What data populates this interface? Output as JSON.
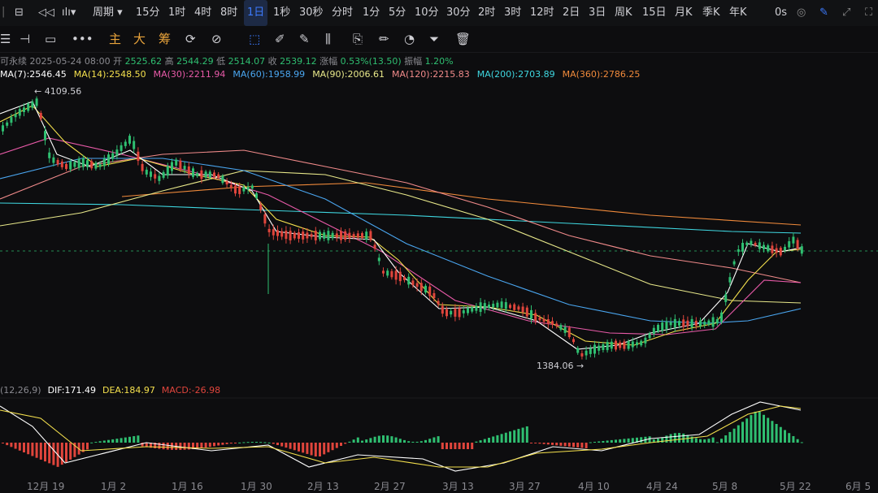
{
  "topbar": {
    "items": [
      "|",
      "⊟",
      "◁◁",
      "ılı▾",
      "周期 ▾",
      "15分",
      "1时",
      "4时",
      "8时",
      "1日",
      "1秒",
      "30秒",
      "分时",
      "1分",
      "5分",
      "10分",
      "30分",
      "2时",
      "3时",
      "12时",
      "2日",
      "3日",
      "周K",
      "15日",
      "月K",
      "季K",
      "年K"
    ],
    "active": "1日",
    "right_label": "0s"
  },
  "toolbar": {
    "labels": [
      "主",
      "大",
      "筹"
    ]
  },
  "info": {
    "symbol_suffix": "可永续",
    "date": "2025-05-24 08:00",
    "open_label": "开",
    "open": "2525.62",
    "high_label": "高",
    "high": "2544.29",
    "low_label": "低",
    "low": "2514.07",
    "close_label": "收",
    "close": "2539.12",
    "change_label": "涨幅",
    "change": "0.53%(13.50)",
    "amp_label": "振幅",
    "amp": "1.20%"
  },
  "ma_legend": [
    {
      "label": "MA(7):2546.45",
      "color": "#ffffff"
    },
    {
      "label": "MA(14):2548.50",
      "color": "#f4e04d"
    },
    {
      "label": "MA(30):2211.94",
      "color": "#e85aa8"
    },
    {
      "label": "MA(60):1958.99",
      "color": "#4aa6f0"
    },
    {
      "label": "MA(90):2006.61",
      "color": "#e8e88a"
    },
    {
      "label": "MA(120):2215.83",
      "color": "#f08a8a"
    },
    {
      "label": "MA(200):2703.89",
      "color": "#3fd7e0"
    },
    {
      "label": "MA(360):2786.25",
      "color": "#f08a3b"
    }
  ],
  "macd_legend": [
    {
      "label": "(12,26,9)",
      "color": "#8a8a90"
    },
    {
      "label": "DIF:171.49",
      "color": "#ffffff"
    },
    {
      "label": "DEA:184.97",
      "color": "#f4e04d"
    },
    {
      "label": "MACD:-26.98",
      "color": "#e0453c"
    }
  ],
  "chart_data": {
    "type": "candlestick",
    "high_marker": "4109.56",
    "low_marker": "1384.06",
    "x_tick_labels": [
      "12月 19",
      "1月 2",
      "1月 16",
      "1月 30",
      "2月 13",
      "2月 27",
      "3月 13",
      "3月 27",
      "4月 10",
      "4月 24",
      "5月 8",
      "5月 22",
      "6月 5"
    ],
    "colors": {
      "up": "#2fbf71",
      "down": "#e0453c"
    }
  }
}
